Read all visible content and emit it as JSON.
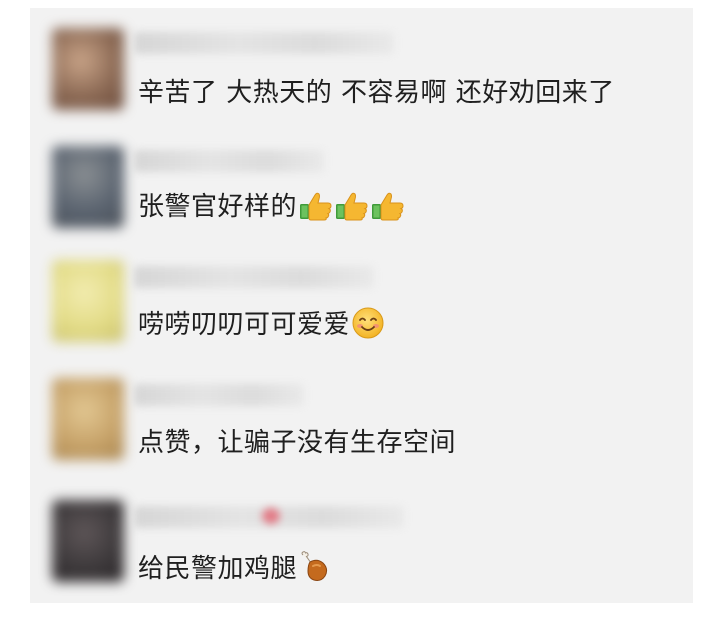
{
  "comments": [
    {
      "text": "辛苦了 大热天的 不容易啊 还好劝回来了",
      "emojis": [],
      "avatar_colors": [
        "#8c6a55",
        "#c9a488",
        "#6a4a3a"
      ]
    },
    {
      "text": "张警官好样的",
      "emojis": [
        "thumbs-up-icon",
        "thumbs-up-icon",
        "thumbs-up-icon"
      ],
      "avatar_colors": [
        "#5b6470",
        "#8a8f93",
        "#4a5058"
      ]
    },
    {
      "text": "唠唠叨叨可可爱爱",
      "emojis": [
        "smiling-face-icon"
      ],
      "avatar_colors": [
        "#e3dc88",
        "#f2ecb0",
        "#c9c06a"
      ]
    },
    {
      "text": "点赞，让骗子没有生存空间",
      "emojis": [],
      "avatar_colors": [
        "#c7a36a",
        "#e2c792",
        "#a8844e"
      ]
    },
    {
      "text": "给民警加鸡腿",
      "emojis": [
        "drumstick-icon"
      ],
      "avatar_colors": [
        "#3e3a3c",
        "#5e5658",
        "#2a2628"
      ]
    }
  ],
  "colors": {
    "panel_bg": "#f2f2f2",
    "text": "#1f1f1f",
    "thumb_yellow": "#f5b731",
    "cuff_green": "#3f9b3a"
  }
}
